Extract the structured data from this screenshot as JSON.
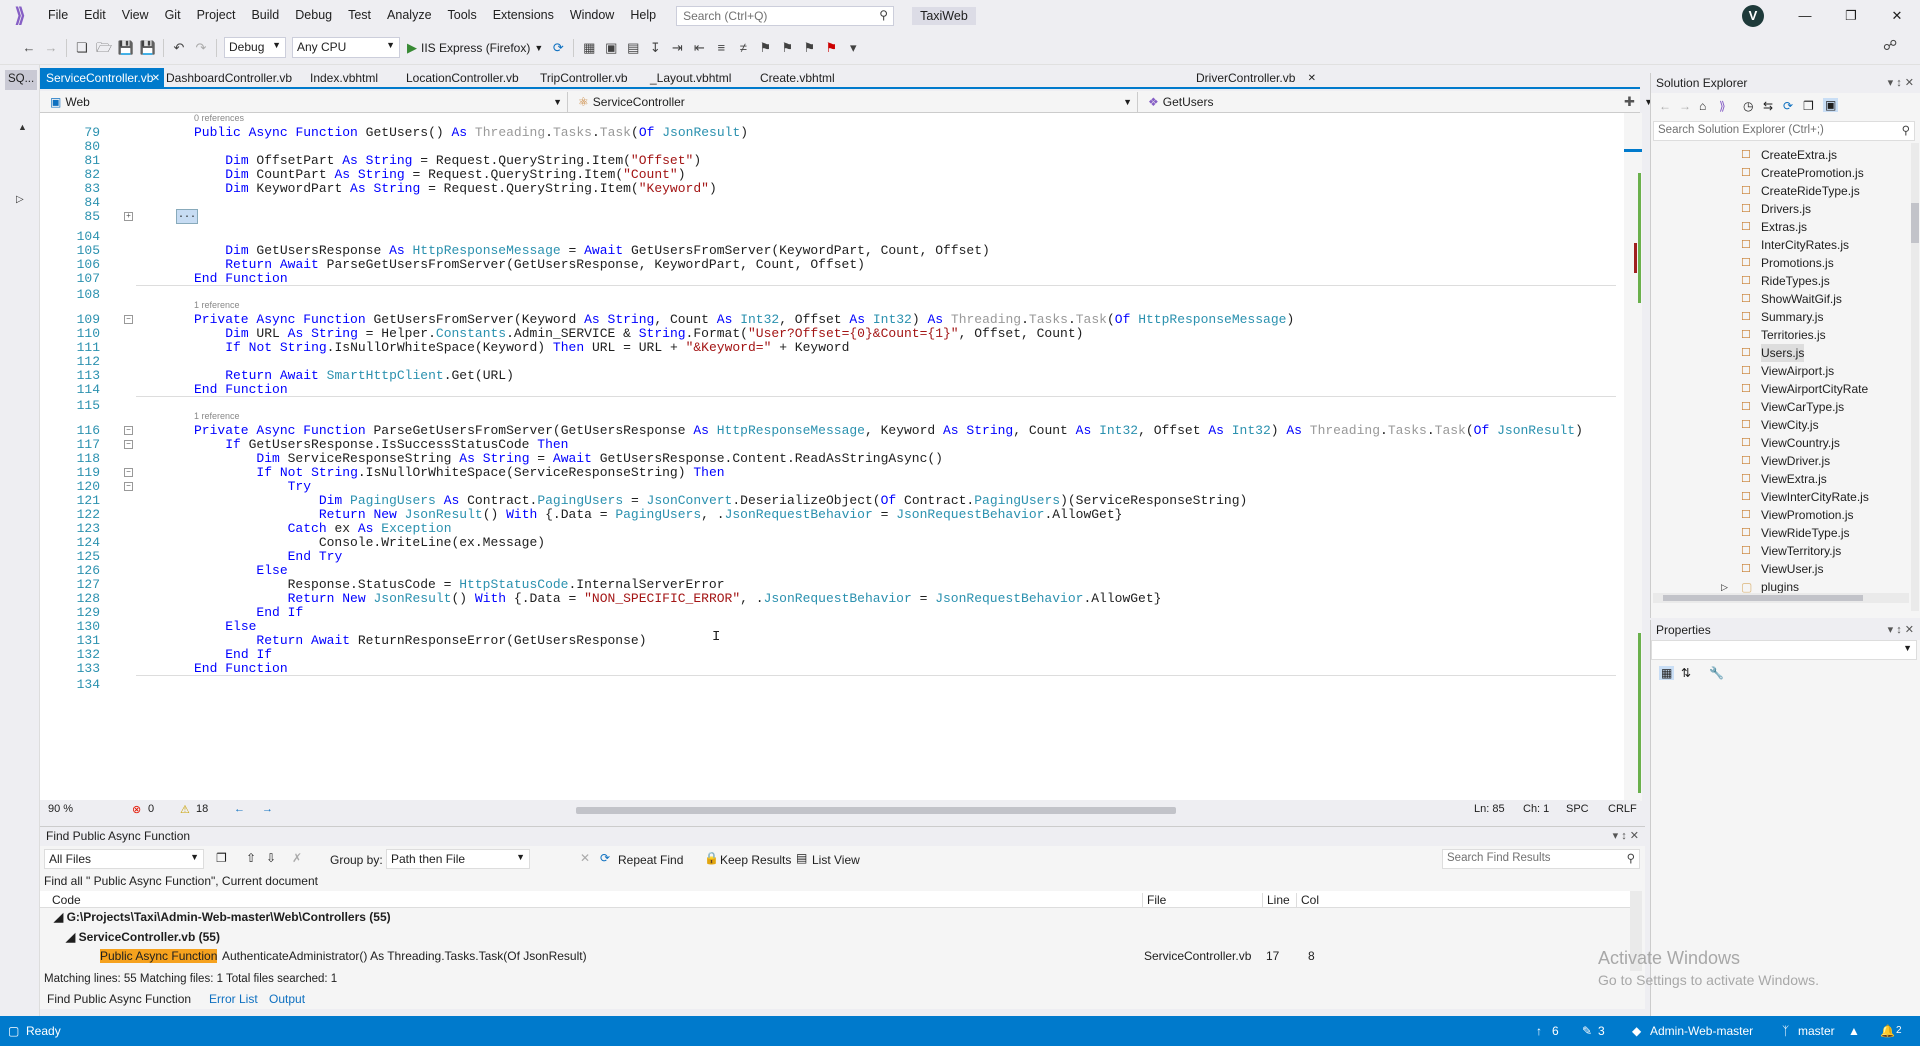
{
  "menu": [
    "File",
    "Edit",
    "View",
    "Git",
    "Project",
    "Build",
    "Debug",
    "Test",
    "Analyze",
    "Tools",
    "Extensions",
    "Window",
    "Help"
  ],
  "search_placeholder": "Search (Ctrl+Q)",
  "solution_name": "TaxiWeb",
  "avatar_letter": "V",
  "toolbar": {
    "config": "Debug",
    "platform": "Any CPU",
    "run_label": "IIS Express (Firefox)"
  },
  "left_tab": "SQ...",
  "doc_tabs": [
    "ServiceController.vb",
    "DashboardController.vb",
    "Index.vbhtml",
    "LocationController.vb",
    "TripController.vb",
    "_Layout.vbhtml",
    "Create.vbhtml",
    "DriverController.vb"
  ],
  "nav": {
    "project": "Web",
    "class": "ServiceController",
    "member": "GetUsers"
  },
  "code": {
    "refs": {
      "r0": "0 references",
      "r1": "1 reference",
      "r2": "1 reference"
    },
    "lines": [
      {
        "n": "79",
        "t": "Public Async Function GetUsers() As Threading.Tasks.Task(Of JsonResult)"
      },
      {
        "n": "80",
        "t": ""
      },
      {
        "n": "81",
        "t": "    Dim OffsetPart As String = Request.QueryString.Item(\"Offset\")"
      },
      {
        "n": "82",
        "t": "    Dim CountPart As String = Request.QueryString.Item(\"Count\")"
      },
      {
        "n": "83",
        "t": "    Dim KeywordPart As String = Request.QueryString.Item(\"Keyword\")"
      },
      {
        "n": "84",
        "t": ""
      },
      {
        "n": "85",
        "t": ""
      },
      {
        "n": "104",
        "t": ""
      },
      {
        "n": "105",
        "t": "    Dim GetUsersResponse As HttpResponseMessage = Await GetUsersFromServer(KeywordPart, Count, Offset)"
      },
      {
        "n": "106",
        "t": "    Return Await ParseGetUsersFromServer(GetUsersResponse, KeywordPart, Count, Offset)"
      },
      {
        "n": "107",
        "t": "End Function"
      },
      {
        "n": "108",
        "t": ""
      },
      {
        "n": "109",
        "t": "Private Async Function GetUsersFromServer(Keyword As String, Count As Int32, Offset As Int32) As Threading.Tasks.Task(Of HttpResponseMessage)"
      },
      {
        "n": "110",
        "t": "    Dim URL As String = Helper.Constants.Admin_SERVICE & String.Format(\"User?Offset={0}&Count={1}\", Offset, Count)"
      },
      {
        "n": "111",
        "t": "    If Not String.IsNullOrWhiteSpace(Keyword) Then URL = URL + \"&Keyword=\" + Keyword"
      },
      {
        "n": "112",
        "t": ""
      },
      {
        "n": "113",
        "t": "    Return Await SmartHttpClient.Get(URL)"
      },
      {
        "n": "114",
        "t": "End Function"
      },
      {
        "n": "115",
        "t": ""
      },
      {
        "n": "116",
        "t": "Private Async Function ParseGetUsersFromServer(GetUsersResponse As HttpResponseMessage, Keyword As String, Count As Int32, Offset As Int32) As Threading.Tasks.Task(Of JsonResult)"
      },
      {
        "n": "117",
        "t": "    If GetUsersResponse.IsSuccessStatusCode Then"
      },
      {
        "n": "118",
        "t": "        Dim ServiceResponseString As String = Await GetUsersResponse.Content.ReadAsStringAsync()"
      },
      {
        "n": "119",
        "t": "        If Not String.IsNullOrWhiteSpace(ServiceResponseString) Then"
      },
      {
        "n": "120",
        "t": "            Try"
      },
      {
        "n": "121",
        "t": "                Dim PagingUsers As Contract.PagingUsers = JsonConvert.DeserializeObject(Of Contract.PagingUsers)(ServiceResponseString)"
      },
      {
        "n": "122",
        "t": "                Return New JsonResult() With {.Data = PagingUsers, .JsonRequestBehavior = JsonRequestBehavior.AllowGet}"
      },
      {
        "n": "123",
        "t": "            Catch ex As Exception"
      },
      {
        "n": "124",
        "t": "                Console.WriteLine(ex.Message)"
      },
      {
        "n": "125",
        "t": "            End Try"
      },
      {
        "n": "126",
        "t": "        Else"
      },
      {
        "n": "127",
        "t": "            Response.StatusCode = HttpStatusCode.InternalServerError"
      },
      {
        "n": "128",
        "t": "            Return New JsonResult() With {.Data = \"NON_SPECIFIC_ERROR\", .JsonRequestBehavior = JsonRequestBehavior.AllowGet}"
      },
      {
        "n": "129",
        "t": "        End If"
      },
      {
        "n": "130",
        "t": "    Else"
      },
      {
        "n": "131",
        "t": "        Return Await ReturnResponseError(GetUsersResponse)"
      },
      {
        "n": "132",
        "t": "    End If"
      },
      {
        "n": "133",
        "t": "End Function"
      },
      {
        "n": "134",
        "t": ""
      }
    ]
  },
  "editor_status": {
    "zoom": "90 %",
    "errors": "0",
    "warnings": "18",
    "ln": "Ln: 85",
    "ch": "Ch: 1",
    "spc": "SPC",
    "eol": "CRLF"
  },
  "solution_explorer": {
    "title": "Solution Explorer",
    "search_placeholder": "Search Solution Explorer (Ctrl+;)",
    "files": [
      "CreateExtra.js",
      "CreatePromotion.js",
      "CreateRideType.js",
      "Drivers.js",
      "Extras.js",
      "InterCityRates.js",
      "Promotions.js",
      "RideTypes.js",
      "ShowWaitGif.js",
      "Summary.js",
      "Territories.js",
      "Users.js",
      "ViewAirport.js",
      "ViewAirportCityRate",
      "ViewCarType.js",
      "ViewCity.js",
      "ViewCountry.js",
      "ViewDriver.js",
      "ViewExtra.js",
      "ViewInterCityRate.js",
      "ViewPromotion.js",
      "ViewRideType.js",
      "ViewTerritory.js",
      "ViewUser.js"
    ],
    "selected": "Users.js",
    "folder": "plugins"
  },
  "properties_title": "Properties",
  "find": {
    "title": "Find  Public Async Function",
    "scope": "All Files",
    "group_by_label": "Group by:",
    "group_by": "Path then File",
    "repeat": "Repeat Find",
    "keep": "Keep Results",
    "list_view": "List View",
    "search_placeholder": "Search Find Results",
    "summary": "Find all \" Public Async Function\", Current document",
    "columns": {
      "code": "Code",
      "file": "File",
      "line": "Line",
      "col": "Col"
    },
    "group_path": "G:\\Projects\\Taxi\\Admin-Web-master\\Web\\Controllers (55)",
    "group_file": "ServiceController.vb (55)",
    "result": {
      "match": "Public Async Function",
      "rest": " AuthenticateAdministrator() As Threading.Tasks.Task(Of JsonResult)",
      "file": "ServiceController.vb",
      "line": "17",
      "col": "8"
    },
    "footer": "Matching lines: 55 Matching files: 1 Total files searched: 1"
  },
  "bottom_tabs": [
    "Find  Public Async Function",
    "Error List",
    "Output"
  ],
  "status": {
    "ready": "Ready",
    "up": "6",
    "pencil": "3",
    "repo": "Admin-Web-master",
    "branch": "master",
    "bell": "2"
  },
  "watermark": {
    "line1": "Activate Windows",
    "line2": "Go to Settings to activate Windows."
  }
}
